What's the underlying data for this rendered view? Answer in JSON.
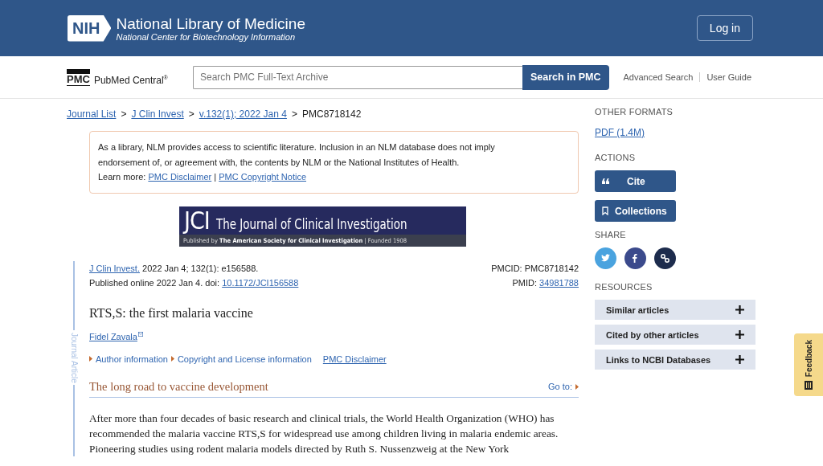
{
  "header": {
    "logo_badge": "NIH",
    "title": "National Library of Medicine",
    "subtitle": "National Center for Biotechnology Information",
    "login": "Log in"
  },
  "searchbar": {
    "logo_mark": "PMC",
    "logo_text": "PubMed Central",
    "logo_sup": "®",
    "placeholder": "Search PMC Full-Text Archive",
    "button": "Search in PMC",
    "links": [
      "Advanced Search",
      "User Guide"
    ]
  },
  "breadcrumbs": {
    "separator": ">",
    "items": [
      {
        "label": "Journal List",
        "kind": "link"
      },
      {
        "label": "J Clin Invest",
        "kind": "link"
      },
      {
        "label": "v.132(1); 2022 Jan 4",
        "kind": "link"
      },
      {
        "label": "PMC8718142",
        "kind": "current"
      }
    ]
  },
  "notice": {
    "text": "As a library, NLM provides access to scientific literature. Inclusion in an NLM database does not imply endorsement of, or agreement with, the contents by NLM or the National Institutes of Health.",
    "learn_label": "Learn more:",
    "links": [
      "PMC Disclaimer",
      "PMC Copyright Notice"
    ],
    "separator": "|"
  },
  "banner": {
    "mark": "JCI",
    "title": "The Journal of Clinical Investigation",
    "byline": "Published by **The American Society for Clinical Investigation** | Founded 1908"
  },
  "article": {
    "side_label": "Journal Article",
    "journal_link": "J Clin Invest.",
    "citation": "2022 Jan 4; 132(1): e156588.",
    "published": "Published online 2022 Jan 4. doi:",
    "doi": "10.1172/JCI156588",
    "pmcid": "PMCID: PMC8718142",
    "pmid_label": "PMID:",
    "pmid": "34981788",
    "title": "RTS,S: the first malaria vaccine",
    "author": "Fidel Zavala",
    "info_links": [
      {
        "label": "Author information",
        "kind": "toggle"
      },
      {
        "label": "Copyright and License information",
        "kind": "toggle"
      },
      {
        "label": "PMC Disclaimer",
        "kind": "link"
      }
    ],
    "section_title": "The long road to vaccine development",
    "goto": "Go to:",
    "paragraph": "After more than four decades of basic research and clinical trials, the World Health Organization (WHO) has recommended the malaria vaccine RTS,S for widespread use among children living in malaria endemic areas. Pioneering studies using rodent malaria models directed by Ruth S. Nussenzweig at the New York"
  },
  "sidebar": {
    "formats_heading": "OTHER FORMATS",
    "pdf": "PDF (1.4M)",
    "actions_heading": "ACTIONS",
    "actions": [
      {
        "label": "Cite",
        "kind": "cite"
      },
      {
        "label": "Collections",
        "kind": "collections"
      }
    ],
    "share_heading": "SHARE",
    "share": [
      {
        "kind": "twitter",
        "color": "#4aa3df"
      },
      {
        "kind": "facebook",
        "color": "#3b4a8c"
      },
      {
        "kind": "link",
        "color": "#1d2c4d"
      }
    ],
    "resources_heading": "RESOURCES",
    "resources": [
      {
        "label": "Similar articles",
        "expanded": false
      },
      {
        "label": "Cited by other articles",
        "expanded": false
      },
      {
        "label": "Links to NCBI Databases",
        "expanded": false
      }
    ]
  },
  "feedback": "Feedback"
}
